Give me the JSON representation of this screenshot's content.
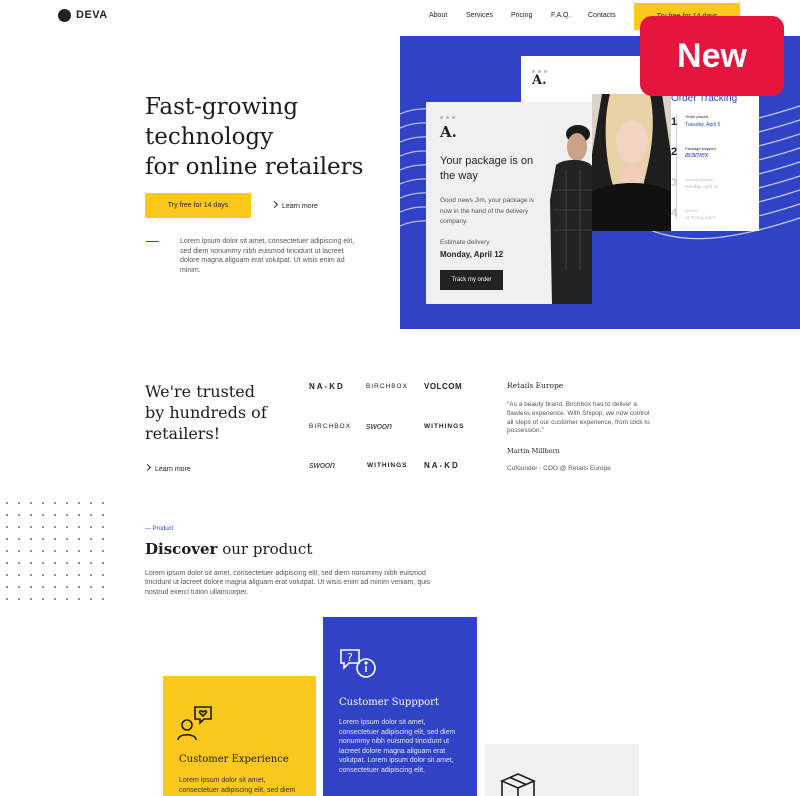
{
  "header": {
    "logo": "DEVA",
    "nav": [
      "About",
      "Services",
      "Pricing",
      "F.A.Q.",
      "Contacts"
    ],
    "cta": "Try free for 14 days"
  },
  "badge": "New",
  "hero": {
    "title_lines": [
      "Fast-growing",
      "technology",
      "for online retailers"
    ],
    "primary_button": "Try free for 14 days",
    "learn_more": "Learn more",
    "description": "Lorem ipsum dolor sit amet, consectetuer adipiscing elit, sed diem nonummy nibh euismod tincidunt ut lacreet dolore magna aliguam erat volutpat. Ut wisis enim ad minim."
  },
  "mock_front": {
    "logo": "A.",
    "heading": "Your package is on the way",
    "body": "Good news Jim, your package is now in the hand of the delivery company.",
    "estimate_label": "Estimate delivery",
    "estimate_date": "Monday, April 12",
    "button": "Track my order"
  },
  "mock_back": {
    "logo": "A.",
    "tracking_title": "Order Tracking",
    "steps": [
      {
        "num": "1",
        "title": "Order placed",
        "date": "Tuesday, April 5"
      },
      {
        "num": "2",
        "title": "Package shipped",
        "carrier": "aramex"
      },
      {
        "num": "3",
        "title": "Internal delivery",
        "date": "Monday, April 12"
      },
      {
        "num": "4",
        "title": "Arrived",
        "date": "At Pickup point"
      }
    ]
  },
  "trusted": {
    "title_lines": [
      "We're trusted",
      "by hundreds of",
      "retailers!"
    ],
    "learn_more": "Learn more",
    "brands": [
      [
        "NA-KD",
        "BIRCHBOX",
        "VOLCOM"
      ],
      [
        "BIRCHBOX",
        "swoon",
        "WITHINGS"
      ],
      [
        "swoon",
        "WITHINGS",
        "NA-KD"
      ]
    ],
    "review": {
      "title": "Retails Europe",
      "quote": "\"As a beauty brand, Birchbox has to deliver a flawless experience. With Shipup, we now control all steps of our customer experience, from click to possession.\"",
      "name": "Martin Millborn",
      "role": "Cofounder - COO @ Retails Europe"
    }
  },
  "product": {
    "tag": "— Product",
    "title_bold": "Discover",
    "title_rest": " our product",
    "description": "Lorem ipsum dolor sit amet, consectetuer adipiscing elit, sed diem nonummy nibh euismod tincidunt ut lacreet dolore magna aliguam erat volutpat. Ut wisis enim ad minim veniam, quis nostrud exerci tution ullamcorper.",
    "cards": [
      {
        "title": "Customer Experience",
        "text": "Lorem ipsum dolor sit amet, consectetuer adipiscing elit, sed diem",
        "icon": "customer-experience-icon"
      },
      {
        "title": "Customer Suppport",
        "text": "Lorem ipsum dolor sit amet, consectetuer adipiscing elit, sed diem nonummy nibh euismod tincidunt ut lacreet dolore magna aliguam erat volutpat. Lorem ipsum dolor sit amet, consectetuer adipiscing elit.",
        "icon": "chat-support-icon"
      },
      {
        "title": "",
        "text": "",
        "icon": "package-box-icon"
      }
    ]
  },
  "colors": {
    "accent_yellow": "#fbc81e",
    "brand_blue": "#3043c6",
    "badge_red": "#e5153f"
  }
}
